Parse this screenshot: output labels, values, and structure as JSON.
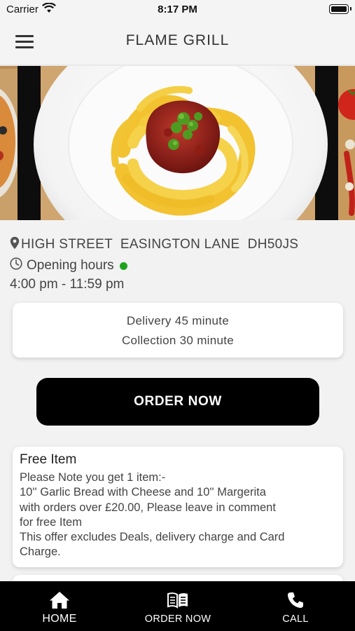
{
  "status_bar": {
    "carrier": "Carrier",
    "time": "8:17 PM"
  },
  "header": {
    "title": "FLAME GRILL",
    "menu_icon": "hamburger-menu-icon"
  },
  "hero": {
    "image": "pasta-dish-photo"
  },
  "info": {
    "address": "HIGH STREET  EASINGTON LANE  DH50JS",
    "hours_label": "Opening hours",
    "hours_time": "4:00 pm - 11:59 pm",
    "open_status_color": "#1ea31e"
  },
  "delivery": {
    "delivery_text": "Delivery 45 minute",
    "collection_text": "Collection 30 minute"
  },
  "order_button": {
    "label": "ORDER NOW"
  },
  "offer": {
    "title": "Free Item",
    "lines": [
      "Please Note you get 1 item:-",
      "10'' Garlic Bread with Cheese and 10'' Margerita",
      "with orders over £20.00, Please leave in comment",
      "for free Item",
      "This offer excludes Deals, delivery charge and Card",
      "Charge."
    ]
  },
  "tabs": [
    {
      "label": "HOME",
      "icon": "home-icon"
    },
    {
      "label": "ORDER NOW",
      "icon": "menu-book-icon"
    },
    {
      "label": "CALL",
      "icon": "phone-icon"
    }
  ]
}
